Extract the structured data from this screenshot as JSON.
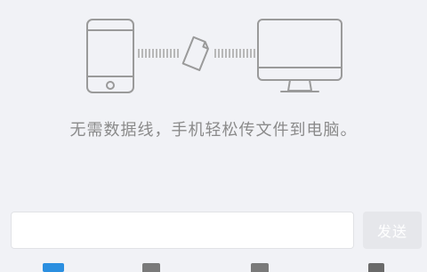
{
  "tagline": "无需数据线，手机轻松传文件到电脑。",
  "composer": {
    "value": "",
    "placeholder": "",
    "send_label": "发送"
  },
  "illustration": {
    "icons": [
      "phone-icon",
      "file-icon",
      "monitor-icon"
    ]
  },
  "toolbar": {
    "icons": [
      "image-icon",
      "camera-icon",
      "folder-icon",
      "document-icon"
    ]
  },
  "colors": {
    "background": "#f1f2f6",
    "icon_stroke": "#9a9a9a",
    "tagline": "#8a8a8a",
    "input_bg": "#ffffff",
    "send_button_bg": "#e6e7eb",
    "send_button_text": "#ffffff",
    "image_tool": "#2b8fe0"
  }
}
